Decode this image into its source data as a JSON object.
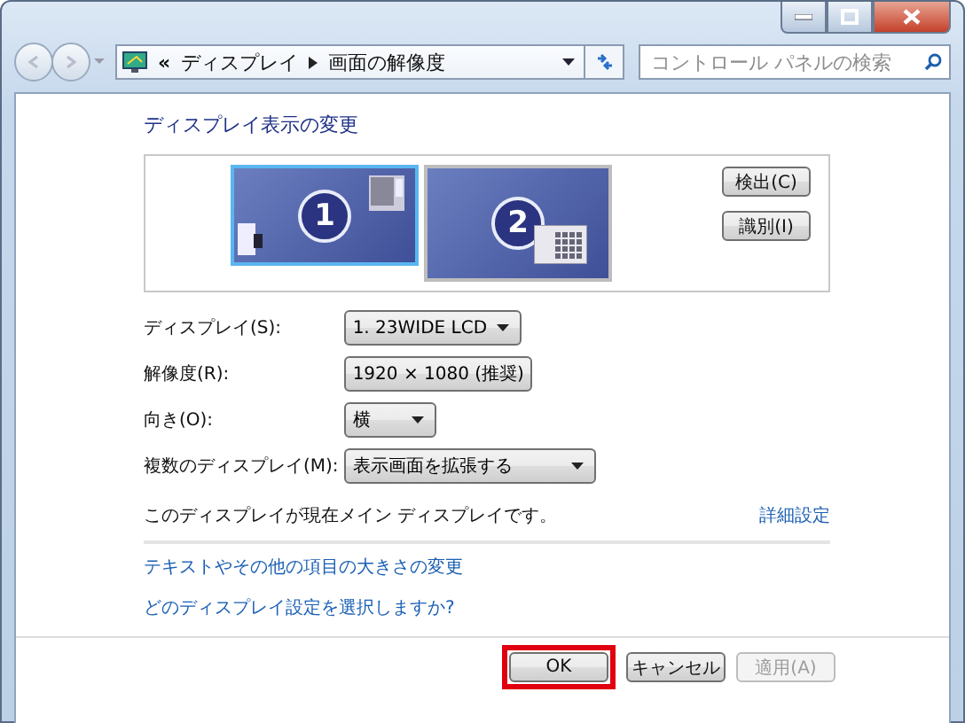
{
  "address_bar": {
    "overflow": "«",
    "breadcrumb": [
      "ディスプレイ",
      "画面の解像度"
    ]
  },
  "search": {
    "placeholder": "コントロール パネルの検索"
  },
  "heading": "ディスプレイ表示の変更",
  "monitors": [
    {
      "label": "1",
      "selected": true
    },
    {
      "label": "2",
      "selected": false
    }
  ],
  "side_buttons": [
    "検出(C)",
    "識別(I)"
  ],
  "settings": [
    {
      "label": "ディスプレイ(S):",
      "value": "1. 23WIDE LCD"
    },
    {
      "label": "解像度(R):",
      "value": "1920 × 1080 (推奨)"
    },
    {
      "label": "向き(O):",
      "value": "横"
    },
    {
      "label": "複数のディスプレイ(M):",
      "value": "表示画面を拡張する"
    }
  ],
  "note": "このディスプレイが現在メイン ディスプレイです。",
  "advanced_link": "詳細設定",
  "links": [
    "テキストやその他の項目の大きさの変更",
    "どのディスプレイ設定を選択しますか?"
  ],
  "buttons": [
    {
      "label": "OK",
      "disabled": false,
      "highlighted": true
    },
    {
      "label": "キャンセル",
      "disabled": false,
      "highlighted": false
    },
    {
      "label": "適用(A)",
      "disabled": true,
      "highlighted": false
    }
  ]
}
